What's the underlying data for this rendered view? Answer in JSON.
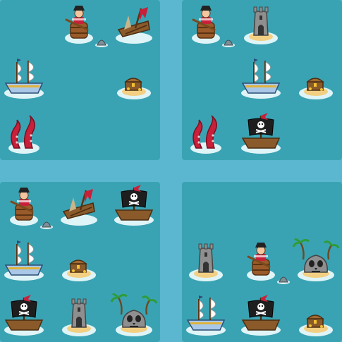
{
  "colors": {
    "board_bg": "#5ab7cf",
    "panel_bg": "#3aa3b3",
    "water_shallow": "#dff4f7",
    "sand": "#f2cf83",
    "pirate_flag_red": "#c8203a"
  },
  "panels": [
    {
      "name": "puzzle-panel-top-left",
      "tiles": [
        {
          "icon": "pirate-in-barrel-icon",
          "row": 0,
          "col": 1
        },
        {
          "icon": "shark-fin-icon",
          "row": 0,
          "col": 1,
          "variant": "fin"
        },
        {
          "icon": "shipwreck-icon",
          "row": 0,
          "col": 2
        },
        {
          "icon": "navy-ship-icon",
          "row": 1,
          "col": 0
        },
        {
          "icon": "treasure-island-icon",
          "row": 1,
          "col": 2
        },
        {
          "icon": "kraken-tentacles-icon",
          "row": 2,
          "col": 0
        }
      ]
    },
    {
      "name": "puzzle-panel-top-right",
      "tiles": [
        {
          "icon": "pirate-in-barrel-icon",
          "row": 0,
          "col": 0
        },
        {
          "icon": "shark-fin-icon",
          "row": 0,
          "col": 0,
          "variant": "fin"
        },
        {
          "icon": "stone-tower-island-icon",
          "row": 0,
          "col": 1
        },
        {
          "icon": "navy-ship-icon",
          "row": 1,
          "col": 1
        },
        {
          "icon": "treasure-island-icon",
          "row": 1,
          "col": 2
        },
        {
          "icon": "kraken-tentacles-icon",
          "row": 2,
          "col": 0
        },
        {
          "icon": "pirate-ship-icon",
          "row": 2,
          "col": 1
        }
      ]
    },
    {
      "name": "puzzle-panel-bottom-left",
      "tiles": [
        {
          "icon": "pirate-in-barrel-icon",
          "row": 0,
          "col": 0
        },
        {
          "icon": "shark-fin-icon",
          "row": 0,
          "col": 0,
          "variant": "fin"
        },
        {
          "icon": "shipwreck-icon",
          "row": 0,
          "col": 1
        },
        {
          "icon": "pirate-ship-icon",
          "row": 0,
          "col": 2
        },
        {
          "icon": "navy-ship-icon",
          "row": 1,
          "col": 0
        },
        {
          "icon": "treasure-island-icon",
          "row": 1,
          "col": 1
        },
        {
          "icon": "pirate-ship-icon",
          "row": 2,
          "col": 0
        },
        {
          "icon": "stone-tower-island-icon",
          "row": 2,
          "col": 1
        },
        {
          "icon": "skull-rock-island-icon",
          "row": 2,
          "col": 2
        }
      ]
    },
    {
      "name": "puzzle-panel-bottom-right",
      "tiles": [
        {
          "icon": "stone-tower-island-icon",
          "row": 1,
          "col": 0
        },
        {
          "icon": "pirate-in-barrel-icon",
          "row": 1,
          "col": 1
        },
        {
          "icon": "shark-fin-icon",
          "row": 1,
          "col": 1,
          "variant": "fin"
        },
        {
          "icon": "skull-rock-island-icon",
          "row": 1,
          "col": 2
        },
        {
          "icon": "navy-ship-icon",
          "row": 2,
          "col": 0
        },
        {
          "icon": "pirate-ship-icon",
          "row": 2,
          "col": 1
        },
        {
          "icon": "treasure-island-icon",
          "row": 2,
          "col": 2
        }
      ]
    }
  ]
}
